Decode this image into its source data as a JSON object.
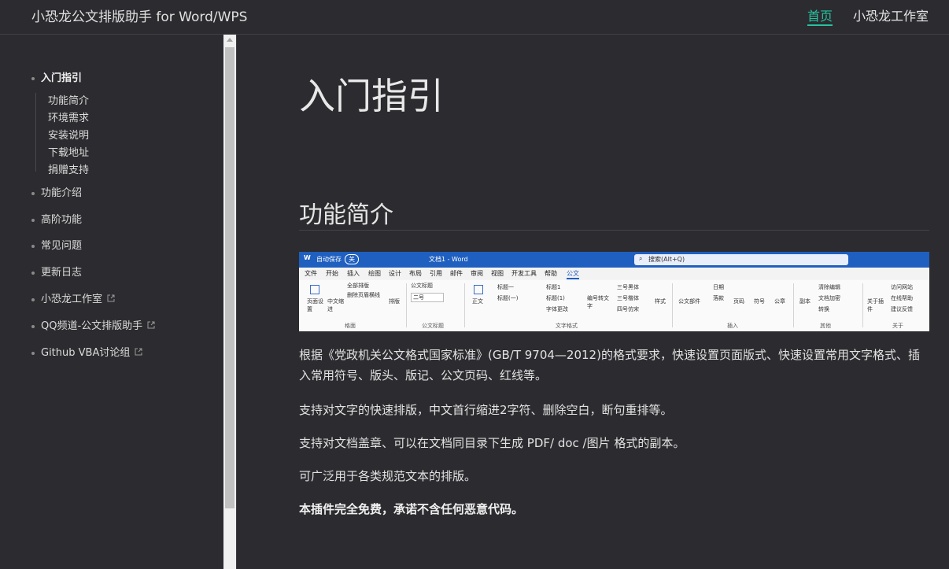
{
  "header": {
    "site_title": "小恐龙公文排版助手 for Word/WPS",
    "nav": [
      {
        "label": "首页",
        "active": true
      },
      {
        "label": "小恐龙工作室",
        "active": false
      }
    ],
    "accent_color": "#25c2a0"
  },
  "sidebar": {
    "sections": [
      {
        "label": "入门指引",
        "active": true
      },
      {
        "label": "功能介绍"
      },
      {
        "label": "高阶功能"
      },
      {
        "label": "常见问题"
      },
      {
        "label": "更新日志"
      },
      {
        "label": "小恐龙工作室",
        "external": true
      },
      {
        "label": "QQ频道-公文排版助手",
        "external": true
      },
      {
        "label": "Github VBA讨论组",
        "external": true
      }
    ],
    "sub_items": [
      "功能简介",
      "环境需求",
      "安装说明",
      "下载地址",
      "捐赠支持"
    ]
  },
  "main": {
    "title": "入门指引",
    "section_title": "功能简介",
    "paragraphs": [
      "根据《党政机关公文格式国家标准》(GB/T 9704—2012)的格式要求，快速设置页面版式、快速设置常用文字格式、插入常用符号、版头、版记、公文页码、红线等。",
      "支持对文字的快速排版，中文首行缩进2字符、删除空白，断句重排等。",
      "支持对文档盖章、可以在文档同目录下生成 PDF/ doc /图片 格式的副本。",
      "可广泛用于各类规范文本的排版。",
      "本插件完全免费，承诺不含任何恶意代码。"
    ]
  },
  "screenshot": {
    "title_bar": {
      "autosave": "自动保存",
      "toggle": "关",
      "doc_name": "文档1 - Word",
      "search": "搜索(Alt+Q)"
    },
    "menu": [
      "文件",
      "开始",
      "插入",
      "绘图",
      "设计",
      "布局",
      "引用",
      "邮件",
      "审阅",
      "视图",
      "开发工具",
      "帮助",
      "公文"
    ],
    "tools": [
      "页面设置",
      "中文缩进",
      "全部排版",
      "删除页眉横线",
      "排版",
      "公文标题",
      "二号",
      "正文",
      "标题一",
      "标题(一)",
      "标题1",
      "标题(1)",
      "字体更改",
      "编号转文字",
      "三号黑体",
      "三号楷体",
      "四号仿宋",
      "样式",
      "公文部件",
      "日期",
      "落款",
      "页码",
      "符号",
      "公章",
      "副本",
      "清除编辑",
      "文档加密",
      "转换",
      "关于插件",
      "访问网站",
      "在线帮助",
      "建议反馈"
    ],
    "groups": [
      "格面",
      "公文标题",
      "文字格式",
      "插入",
      "其他",
      "关于"
    ]
  }
}
